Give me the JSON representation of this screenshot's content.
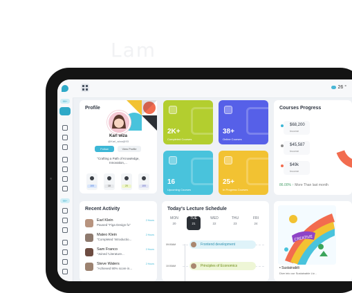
{
  "background_text": "Lam",
  "topbar": {
    "weather_temp": "26 °"
  },
  "sidebar": {
    "badges": [
      "99+",
      "99+"
    ]
  },
  "profile": {
    "title": "Profile",
    "name": "Karl wiza",
    "handle": "@Karl_wiza@93",
    "follow_label": "Follow",
    "view_label": "View Profile",
    "bio": "\"Crafting a Path of Knowledge, Innovation,...",
    "stats": [
      {
        "icon": "clock-icon",
        "value": "100",
        "color": "#d9e6fb",
        "text_color": "#3b6fd8"
      },
      {
        "icon": "document-icon",
        "value": "10",
        "color": "#e7e9ec",
        "text_color": "#333333"
      },
      {
        "icon": "smile-icon",
        "value": "20",
        "color": "#eef6c9",
        "text_color": "#6c8a12"
      },
      {
        "icon": "award-icon",
        "value": "100",
        "color": "#e2e5f5",
        "text_color": "#4a52b8"
      }
    ]
  },
  "stats_cards": [
    {
      "value": "2K+",
      "label": "Completed Courses",
      "color": "#b3ce2f",
      "icon": "calendar-icon"
    },
    {
      "value": "38+",
      "label": "Online Courses",
      "color": "#5660e8",
      "icon": "presentation-icon"
    },
    {
      "value": "16",
      "label": "Upcoming Courses",
      "color": "#49c3dc",
      "icon": "graduation-cap-icon"
    },
    {
      "value": "25+",
      "label": "In Progress Courses",
      "color": "#f2c232",
      "icon": "pencil-icon"
    }
  ],
  "courses_progress": {
    "title": "Courses Progress",
    "legend": [
      {
        "amount": "$68,200",
        "label": "Income",
        "color": "#3db7d6"
      },
      {
        "amount": "$45,587",
        "label": "Income",
        "color": "#8c8c8c"
      },
      {
        "amount": "$49k",
        "label": "Income",
        "color": "#f26c4f"
      }
    ],
    "growth": "86.00%",
    "growth_note": "More Than last month"
  },
  "activity": {
    "title": "Recent Activity",
    "items": [
      {
        "name": "Earl Klein",
        "text": "Paused \"Figa Design fu\"",
        "time": "2 Hours",
        "avatar": "#b8947f"
      },
      {
        "name": "Mateo Klein",
        "text": "\"Completed 'Introductio...",
        "time": "2 Hours",
        "avatar": "#8e7a6e"
      },
      {
        "name": "Sam Franco",
        "text": "\"Joined 'Literature...",
        "time": "2 Hours",
        "avatar": "#6d4c41"
      },
      {
        "name": "Steve Waters",
        "text": "\"Achieved 90% score in...",
        "time": "2 Hours",
        "avatar": "#9c8270"
      }
    ]
  },
  "schedule": {
    "title": "Today's Lecture Schedule",
    "days": [
      {
        "name": "MON",
        "date": "20"
      },
      {
        "name": "TUE",
        "date": "21",
        "active": true
      },
      {
        "name": "WED",
        "date": "22"
      },
      {
        "name": "THU",
        "date": "23"
      },
      {
        "name": "FRI",
        "date": "24"
      }
    ],
    "times": [
      "09:00AM",
      "10:00AM"
    ],
    "events": [
      {
        "title": "Frontend development",
        "color": "#dff3f9",
        "text_color": "#2a8fae"
      },
      {
        "title": "Principles of Economics",
        "color": "#eef6d6",
        "text_color": "#6c8a12"
      }
    ]
  },
  "creative": {
    "banner_text": "CREATIVE",
    "title": "Sustainabili",
    "subtitle": "Dive into our Sustainable Liv..."
  }
}
